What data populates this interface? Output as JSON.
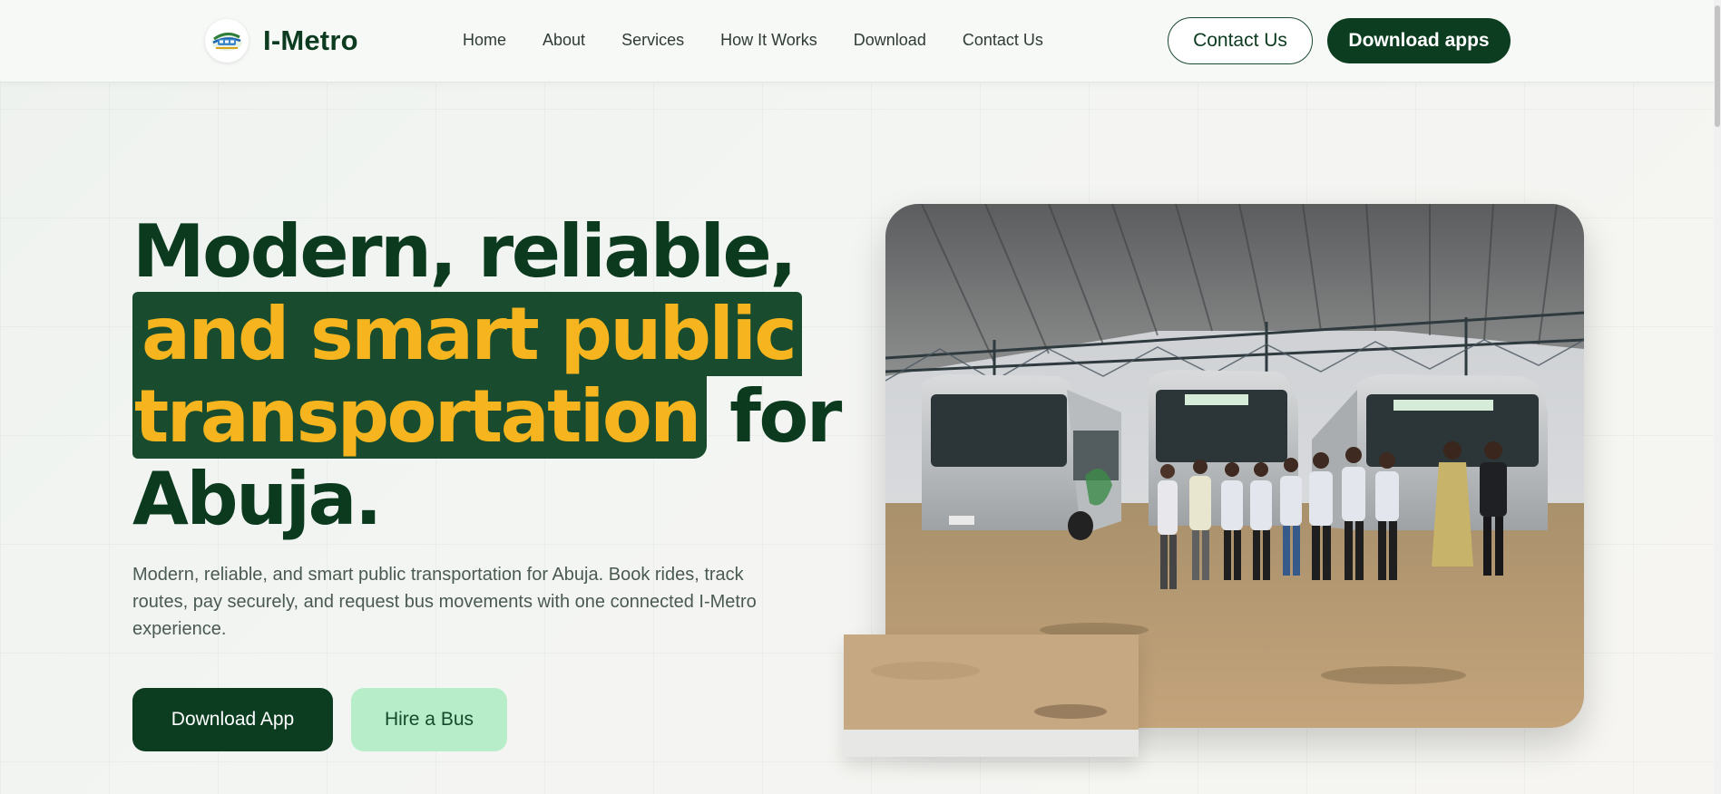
{
  "brand": {
    "name": "I-Metro",
    "logo_text": "I-Metro"
  },
  "nav": {
    "items": [
      {
        "label": "Home"
      },
      {
        "label": "About"
      },
      {
        "label": "Services"
      },
      {
        "label": "How It Works"
      },
      {
        "label": "Download"
      },
      {
        "label": "Contact Us"
      }
    ]
  },
  "header_actions": {
    "contact_label": "Contact Us",
    "download_label": "Download apps"
  },
  "hero": {
    "title_line1": "Modern, reliable,",
    "title_highlight1": "and smart public",
    "title_highlight2": "transportation",
    "title_after_highlight": " for",
    "title_line4": "Abuja.",
    "description": "Modern, reliable, and smart public transportation for Abuja. Book rides, track routes, pay securely, and request bus movements with one connected I-Metro experience.",
    "primary_cta": "Download App",
    "secondary_cta": "Hire a Bus"
  },
  "colors": {
    "brand_dark": "#0d3d21",
    "highlight_bg": "#194c2e",
    "highlight_text": "#f6b51e",
    "secondary_button": "#b7eec9"
  },
  "icons": {
    "logo": "i-metro-bus-logo-icon",
    "photo": "buses-at-terminal-photo"
  }
}
